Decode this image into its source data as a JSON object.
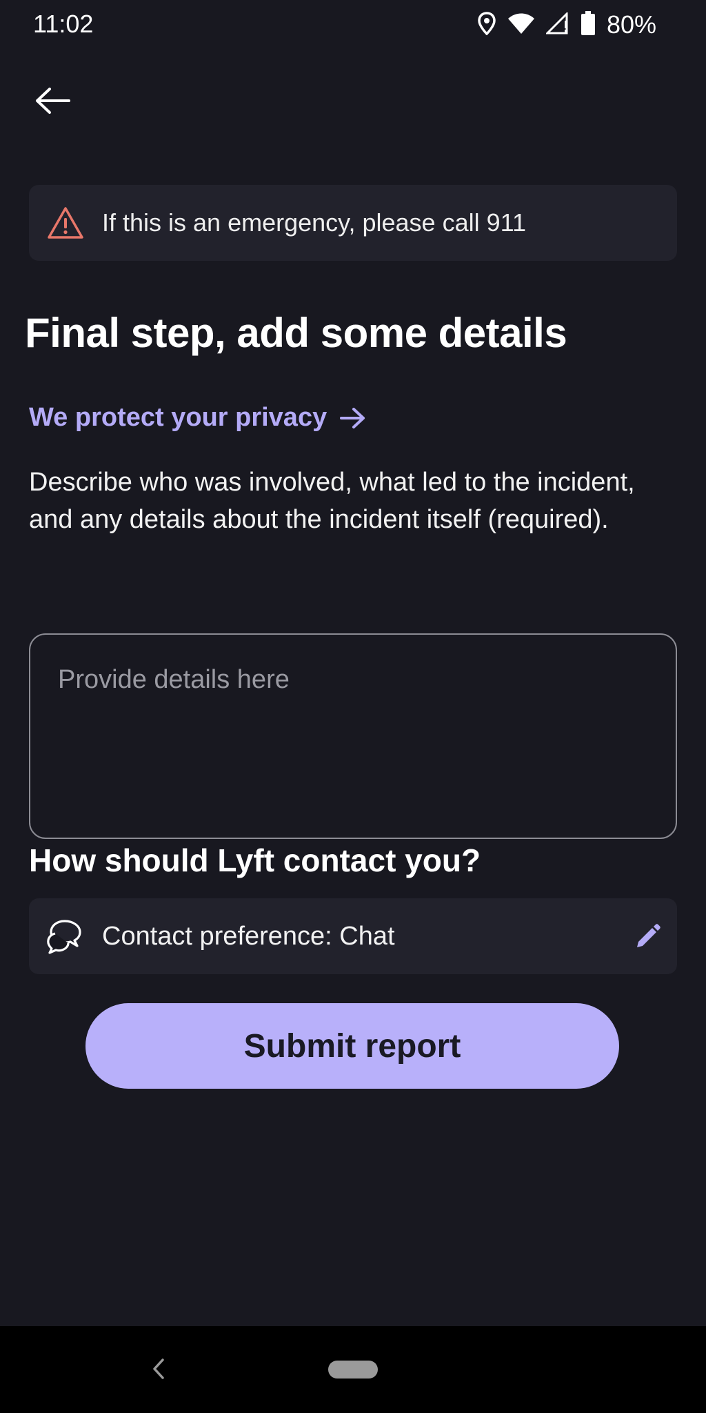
{
  "status_bar": {
    "time": "11:02",
    "battery": "80%",
    "icons": [
      "location-icon",
      "wifi-icon",
      "signal-icon",
      "battery-icon"
    ]
  },
  "nav": {
    "back_icon": "arrow-left-icon"
  },
  "banner": {
    "icon": "warning-triangle-icon",
    "text": "If this is an emergency, please call 911",
    "icon_color": "#e8776a"
  },
  "page": {
    "title": "Final step, add some details",
    "privacy_link": "We protect your privacy",
    "privacy_icon": "arrow-right-icon",
    "description": "Describe who was involved, what led to the incident, and any details about the incident itself (required)."
  },
  "details_input": {
    "placeholder": "Provide details here",
    "value": ""
  },
  "contact": {
    "heading": "How should Lyft contact you?",
    "label": "Contact preference: Chat",
    "icon": "chat-bubbles-icon",
    "edit_icon": "pencil-icon"
  },
  "submit": {
    "label": "Submit report"
  },
  "colors": {
    "background": "#181820",
    "card": "#22222c",
    "accent": "#b4abf7",
    "button": "#b8b0fa"
  },
  "system_nav": {
    "back_icon": "chevron-left-icon",
    "home": "home-pill"
  }
}
